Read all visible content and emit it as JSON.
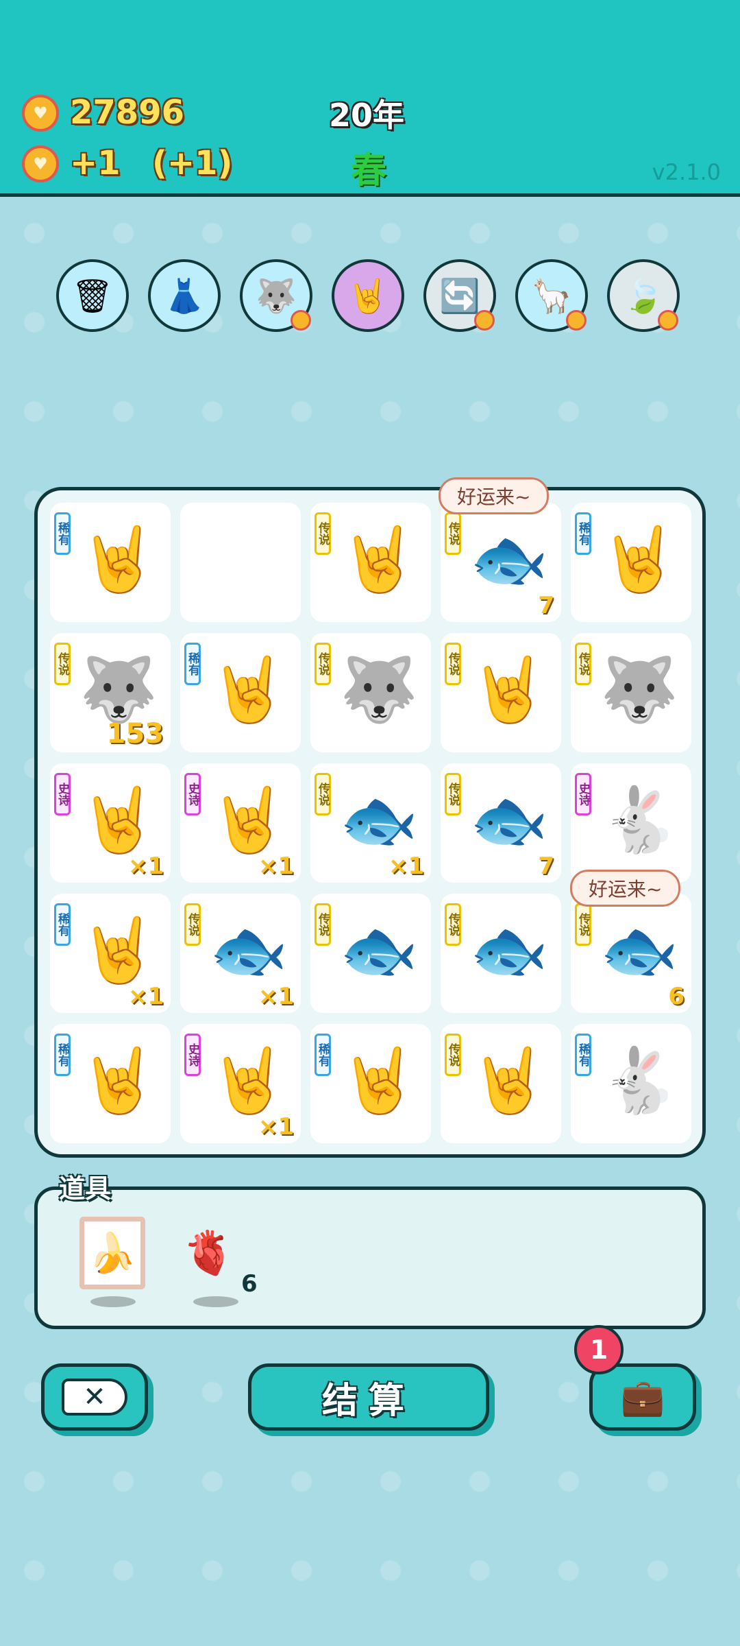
{
  "header": {
    "coins": "27896",
    "income": "+1",
    "bonus": "(+1)",
    "year": "20年",
    "season": "春",
    "version": "v2.1.0"
  },
  "colors": {
    "header_bg": "#20c4c1",
    "background": "#a9dbe4",
    "coin_text": "#ffe25a",
    "season_text": "#2ecc40",
    "rare_tag": "#3aa6e0",
    "legend_tag": "#e8c300",
    "epic_tag": "#d844d8"
  },
  "toolbar": [
    {
      "icon": "garbage-bag-icon",
      "glyph": "🗑",
      "bg": "#bdeefc"
    },
    {
      "icon": "skirt-icon",
      "glyph": "👗",
      "bg": "#bdeefc"
    },
    {
      "icon": "husky-icon",
      "glyph": "🐺",
      "bg": "#bdeefc"
    },
    {
      "icon": "rock-hand-icon",
      "glyph": "🤘",
      "bg": "#d9a8ea"
    },
    {
      "icon": "refresh-icon",
      "glyph": "🔄",
      "bg": "#dfe9ec"
    },
    {
      "icon": "alpacas-icon",
      "glyph": "🦙",
      "bg": "#bdeefc"
    },
    {
      "icon": "leaf-icon",
      "glyph": "🍃",
      "bg": "#dfe9ec"
    }
  ],
  "board": {
    "bubble_text_1": "好运来~",
    "bubble_text_2": "好运来~",
    "cells": [
      {
        "tag": "稀有",
        "tag_type": "rare",
        "glyph": "🤘",
        "count": ""
      },
      {
        "tag": "",
        "tag_type": "",
        "glyph": "",
        "count": ""
      },
      {
        "tag": "传说",
        "tag_type": "legend",
        "glyph": "🤘",
        "count": ""
      },
      {
        "tag": "传说",
        "tag_type": "legend",
        "glyph": "🐟",
        "count": "7"
      },
      {
        "tag": "稀有",
        "tag_type": "rare",
        "glyph": "🤘",
        "count": ""
      },
      {
        "tag": "传说",
        "tag_type": "legend",
        "glyph": "🐺",
        "count": "153"
      },
      {
        "tag": "稀有",
        "tag_type": "rare",
        "glyph": "🤘",
        "count": ""
      },
      {
        "tag": "传说",
        "tag_type": "legend",
        "glyph": "🐺",
        "count": ""
      },
      {
        "tag": "传说",
        "tag_type": "legend",
        "glyph": "🤘",
        "count": ""
      },
      {
        "tag": "传说",
        "tag_type": "legend",
        "glyph": "🐺",
        "count": ""
      },
      {
        "tag": "史诗",
        "tag_type": "epic",
        "glyph": "🤘",
        "count": "×1"
      },
      {
        "tag": "史诗",
        "tag_type": "epic",
        "glyph": "🤘",
        "count": "×1"
      },
      {
        "tag": "传说",
        "tag_type": "legend",
        "glyph": "🐟",
        "count": "×1"
      },
      {
        "tag": "传说",
        "tag_type": "legend",
        "glyph": "🐟",
        "count": "7"
      },
      {
        "tag": "史诗",
        "tag_type": "epic",
        "glyph": "🐇",
        "count": ""
      },
      {
        "tag": "稀有",
        "tag_type": "rare",
        "glyph": "🤘",
        "count": "×1"
      },
      {
        "tag": "传说",
        "tag_type": "legend",
        "glyph": "🐟",
        "count": "×1"
      },
      {
        "tag": "传说",
        "tag_type": "legend",
        "glyph": "🐟",
        "count": ""
      },
      {
        "tag": "传说",
        "tag_type": "legend",
        "glyph": "🐟",
        "count": ""
      },
      {
        "tag": "传说",
        "tag_type": "legend",
        "glyph": "🐟",
        "count": "6"
      },
      {
        "tag": "稀有",
        "tag_type": "rare",
        "glyph": "🤘",
        "count": ""
      },
      {
        "tag": "史诗",
        "tag_type": "epic",
        "glyph": "🤘",
        "count": "×1"
      },
      {
        "tag": "稀有",
        "tag_type": "rare",
        "glyph": "🤘",
        "count": ""
      },
      {
        "tag": "传说",
        "tag_type": "legend",
        "glyph": "🤘",
        "count": ""
      },
      {
        "tag": "稀有",
        "tag_type": "rare",
        "glyph": "🐇",
        "count": ""
      }
    ]
  },
  "items": {
    "title": "道具",
    "banana_glyph": "🍌",
    "liver_glyph": "🫀",
    "liver_count": "6"
  },
  "buttons": {
    "close_glyph": "✕",
    "settle_label": "结算",
    "bag_badge": "1",
    "bag_glyph": "💼"
  }
}
